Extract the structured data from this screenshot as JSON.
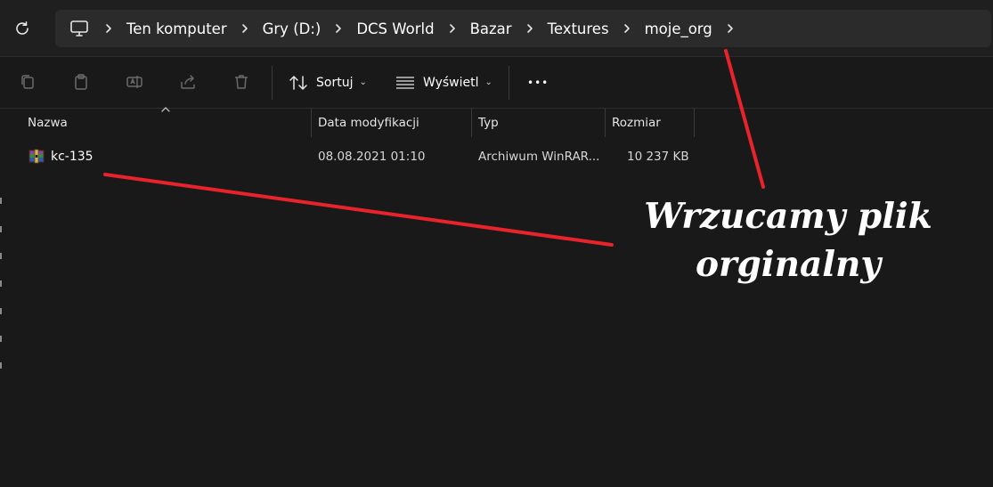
{
  "breadcrumb": {
    "icon": "computer-icon",
    "items": [
      "Ten komputer",
      "Gry (D:)",
      "DCS World",
      "Bazar",
      "Textures",
      "moje_org"
    ]
  },
  "toolbar": {
    "sort_label": "Sortuj",
    "view_label": "Wyświetl",
    "more_label": "•••"
  },
  "columns": {
    "name": "Nazwa",
    "modified": "Data modyfikacji",
    "type": "Typ",
    "size": "Rozmiar"
  },
  "files": [
    {
      "name": "kc-135",
      "modified": "08.08.2021 01:10",
      "type": "Archiwum WinRAR...",
      "size": "10 237 KB",
      "icon": "winrar-archive-icon"
    }
  ],
  "annotation": {
    "line1": "Wrzucamy plik",
    "line2": "orginalny",
    "arrow_color": "#e8232b"
  }
}
